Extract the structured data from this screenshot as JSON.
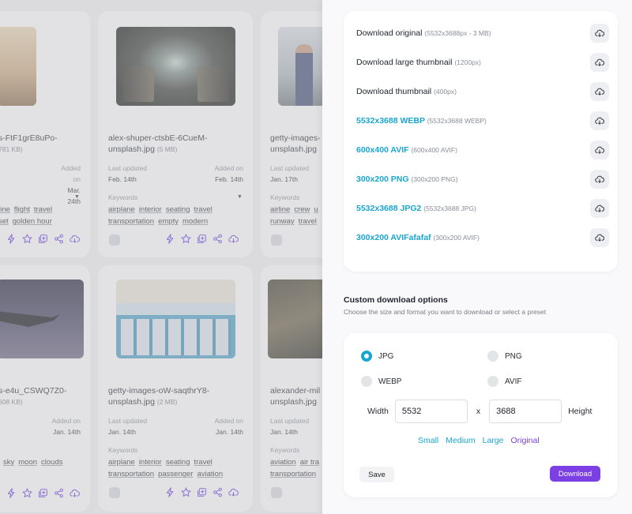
{
  "grid": {
    "cards": [
      {
        "name": "s-FtF1grE8uPo-",
        "size": "781 KB)",
        "added_label": "Added on",
        "added": "Mar. 24th",
        "keywords": [
          "line",
          "flight",
          "travel",
          "set",
          "golden hour"
        ]
      },
      {
        "name": "alex-shuper-ctsbE-6CueM-",
        "name2": "unsplash.jpg",
        "size": "(5 MB)",
        "updated_label": "Last updated",
        "updated": "Feb. 14th",
        "added_label": "Added on",
        "added": "Feb. 14th",
        "kw_label": "Keywords",
        "keywords": [
          "airplane",
          "interior",
          "seating",
          "travel",
          "transportation",
          "empty",
          "modern"
        ]
      },
      {
        "name": "getty-images-",
        "name2": "unsplash.jpg",
        "updated_label": "Last updated",
        "updated": "Jan. 17th",
        "kw_label": "Keywords",
        "keywords": [
          "airline",
          "crew",
          "u",
          "runway",
          "travel"
        ]
      },
      {
        "name": "s-e4u_CSWQ7Z0-",
        "size": "608 KB)",
        "keywords": [
          "sky",
          "moon",
          "clouds"
        ]
      },
      {
        "name": "getty-images-oW-saqthrY8-",
        "name2": "unsplash.jpg",
        "size": "(2 MB)",
        "updated_label": "Last updated",
        "updated": "Jan. 14th",
        "added_label": "Added on",
        "added": "Jan. 14th",
        "kw_label": "Keywords",
        "keywords": [
          "airplane",
          "interior",
          "seating",
          "travel",
          "transportation",
          "passenger",
          "aviation"
        ]
      },
      {
        "name": "alexander-mil",
        "name2": "unsplash.jpg",
        "updated_label": "Last updated",
        "updated": "Jan. 14th",
        "kw_label": "Keywords",
        "keywords": [
          "aviation",
          "air tra",
          "transportation"
        ]
      }
    ],
    "left_added_label": "Added on",
    "left_added": "Jan. 14th"
  },
  "download_options": [
    {
      "label": "Download original",
      "detail": "(5532x3688px - 3 MB)",
      "accent": false
    },
    {
      "label": "Download large thumbnail",
      "detail": "(1200px)",
      "accent": false
    },
    {
      "label": "Download thumbnail",
      "detail": "(400px)",
      "accent": false
    },
    {
      "label": "5532x3688 WEBP",
      "detail": "(5532x3688 WEBP)",
      "accent": true
    },
    {
      "label": "600x400 AVIF",
      "detail": "(600x400 AVIF)",
      "accent": true
    },
    {
      "label": "300x200 PNG",
      "detail": "(300x200 PNG)",
      "accent": true
    },
    {
      "label": "5532x3688 JPG2",
      "detail": "(5532x3688 JPG)",
      "accent": true
    },
    {
      "label": "300x200 AVIFafafaf",
      "detail": "(300x200 AVIF)",
      "accent": true
    }
  ],
  "custom": {
    "title": "Custom download options",
    "subtitle": "Choose the size and format you want to download or select a preset",
    "formats": [
      {
        "label": "JPG",
        "selected": true
      },
      {
        "label": "PNG",
        "selected": false
      },
      {
        "label": "WEBP",
        "selected": false
      },
      {
        "label": "AVIF",
        "selected": false
      }
    ],
    "width_label": "Width",
    "width_value": "5532",
    "times": "x",
    "height_value": "3688",
    "height_label": "Height",
    "presets": [
      "Small",
      "Medium",
      "Large",
      "Original"
    ],
    "selected_preset": "Original",
    "save_label": "Save",
    "download_label": "Download"
  },
  "colors": {
    "accent": "#1aa6d0",
    "primary": "#7b3fe4",
    "icon": "#6a3fe0"
  }
}
